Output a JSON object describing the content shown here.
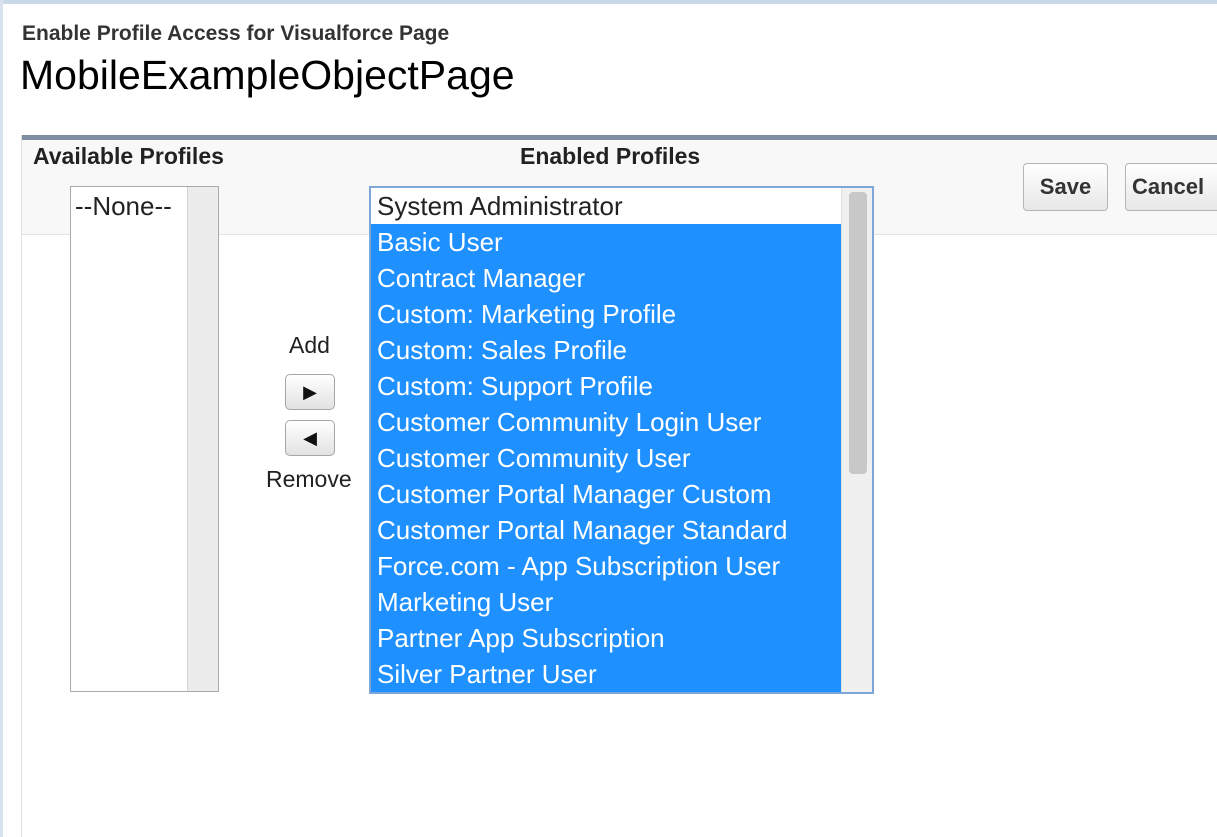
{
  "header": {
    "subtitle": "Enable Profile Access for Visualforce Page",
    "title": "MobileExampleObjectPage"
  },
  "buttons": {
    "save": "Save",
    "cancel": "Cancel"
  },
  "available": {
    "label": "Available Profiles",
    "options": [
      "--None--"
    ]
  },
  "enabled": {
    "label": "Enabled Profiles",
    "options": [
      {
        "text": "System Administrator",
        "selected": false
      },
      {
        "text": "Basic User",
        "selected": true
      },
      {
        "text": "Contract Manager",
        "selected": true
      },
      {
        "text": "Custom: Marketing Profile",
        "selected": true
      },
      {
        "text": "Custom: Sales Profile",
        "selected": true
      },
      {
        "text": "Custom: Support Profile",
        "selected": true
      },
      {
        "text": "Customer Community Login User",
        "selected": true
      },
      {
        "text": "Customer Community User",
        "selected": true
      },
      {
        "text": "Customer Portal Manager Custom",
        "selected": true
      },
      {
        "text": "Customer Portal Manager Standard",
        "selected": true
      },
      {
        "text": "Force.com - App Subscription User",
        "selected": true
      },
      {
        "text": "Marketing User",
        "selected": true
      },
      {
        "text": "Partner App Subscription",
        "selected": true
      },
      {
        "text": "Silver Partner User",
        "selected": true
      }
    ]
  },
  "move": {
    "add_label": "Add",
    "remove_label": "Remove",
    "add_icon": "triangle-right-icon",
    "remove_icon": "triangle-left-icon"
  },
  "colors": {
    "selection": "#1e90ff",
    "header_bar": "#7e8fa3"
  }
}
